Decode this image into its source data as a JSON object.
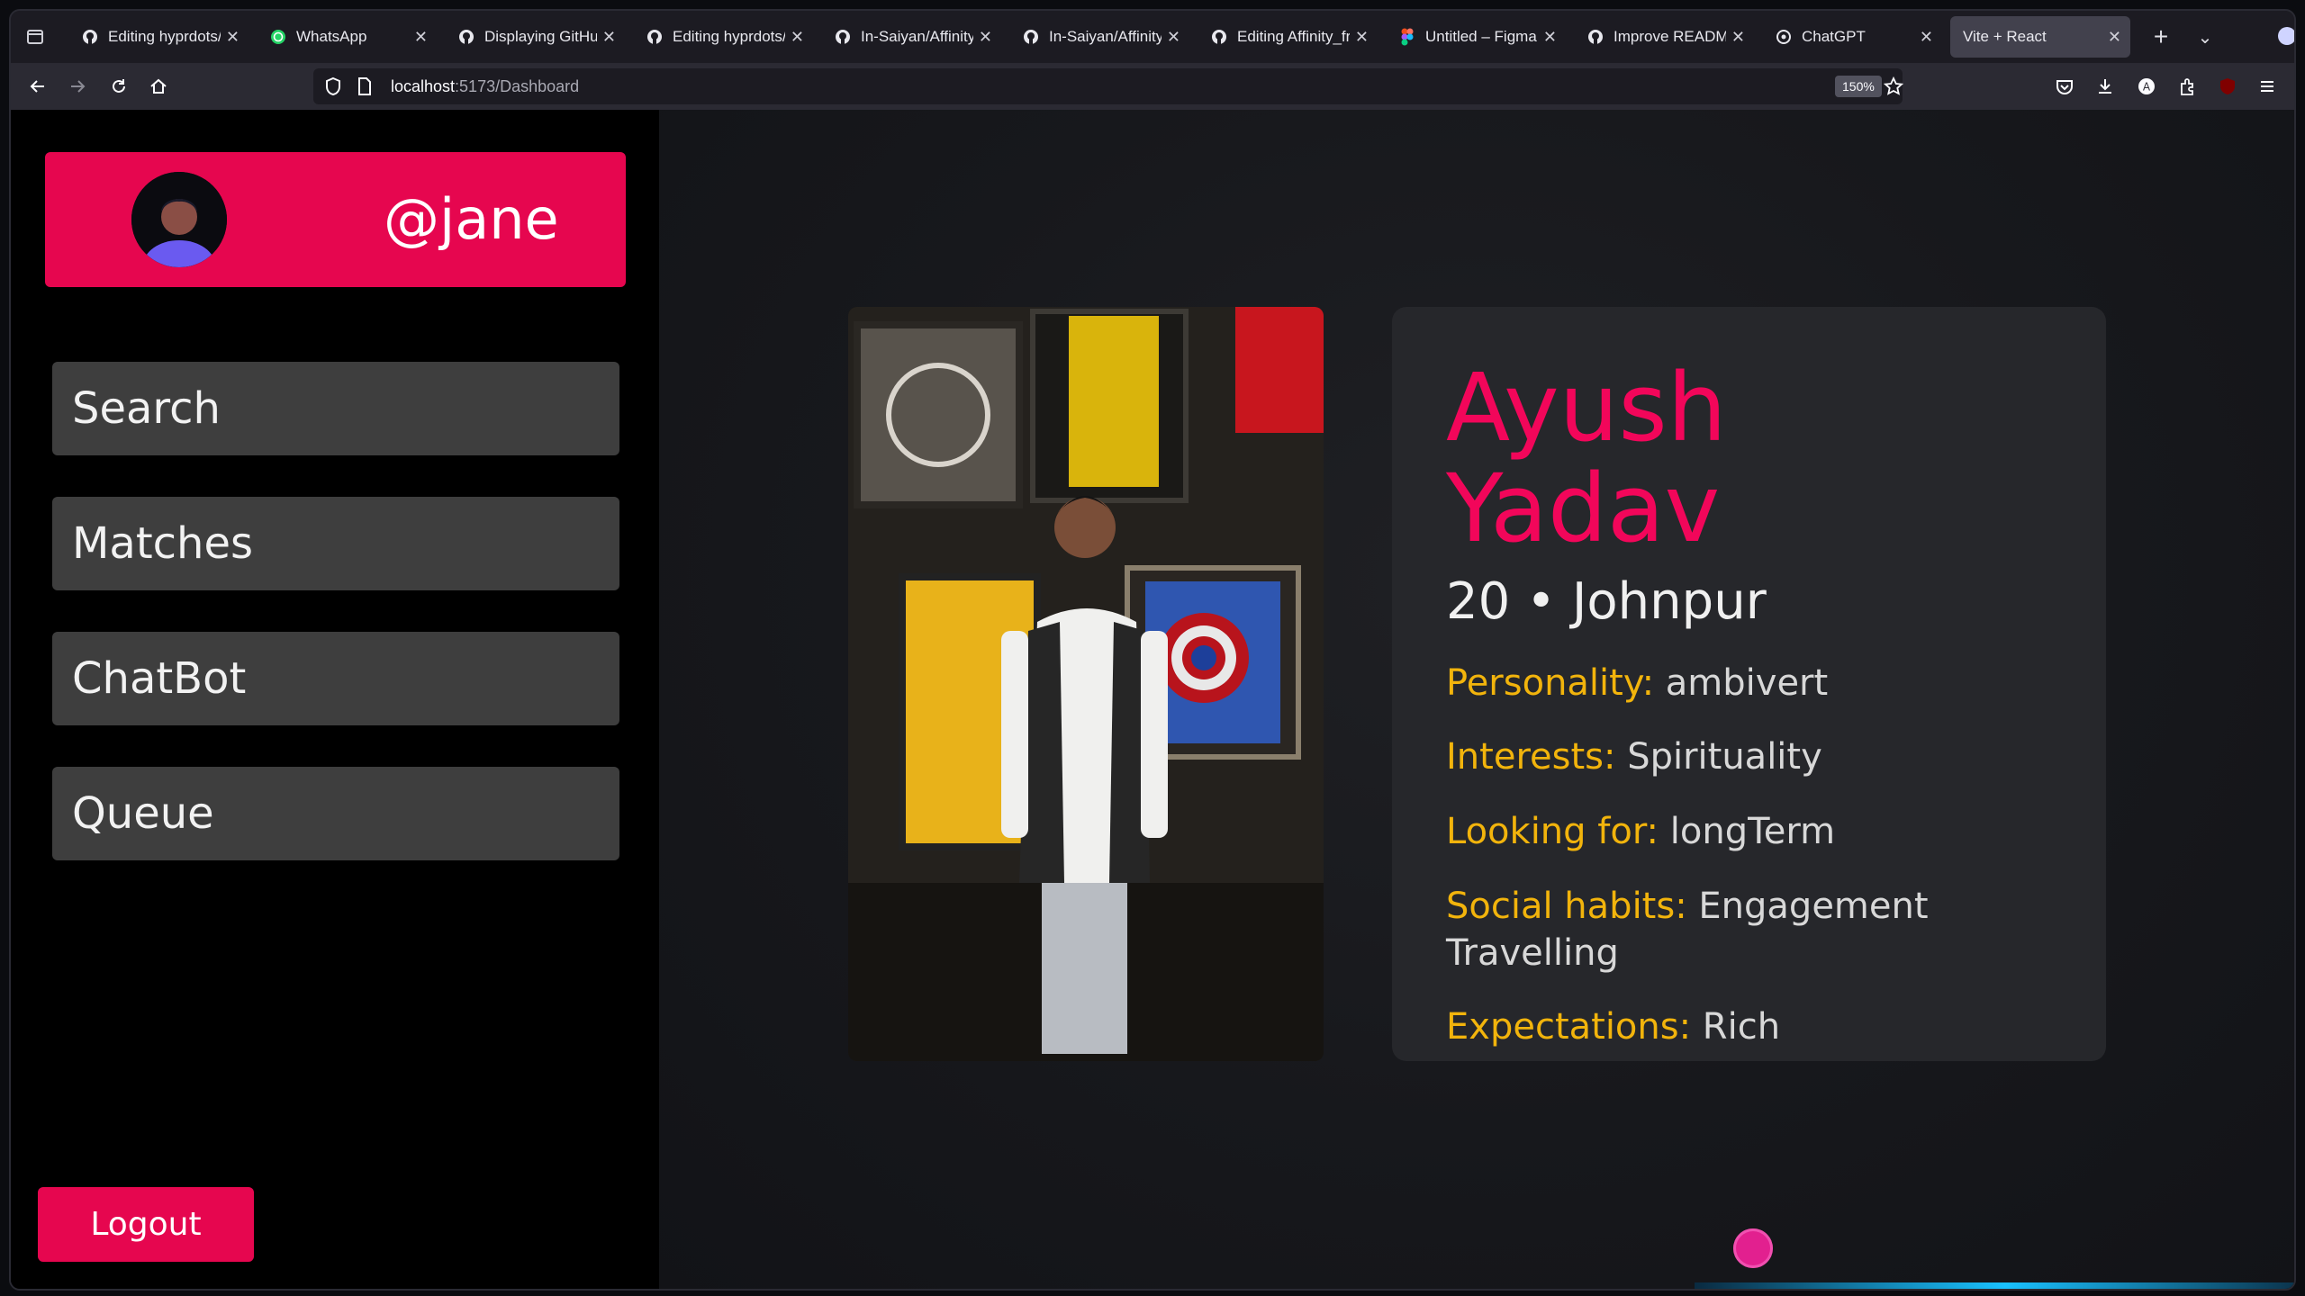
{
  "browser": {
    "tabs": [
      {
        "title": "Editing hyprdots/R",
        "icon": "github-icon"
      },
      {
        "title": "WhatsApp",
        "icon": "whatsapp-icon"
      },
      {
        "title": "Displaying GitHub",
        "icon": "github-icon"
      },
      {
        "title": "Editing hyprdots/R",
        "icon": "github-icon"
      },
      {
        "title": "In-Saiyan/Affinity_",
        "icon": "github-icon"
      },
      {
        "title": "In-Saiyan/Affinity_",
        "icon": "github-icon"
      },
      {
        "title": "Editing Affinity_fr",
        "icon": "github-icon"
      },
      {
        "title": "Untitled – Figma",
        "icon": "figma-icon"
      },
      {
        "title": "Improve README",
        "icon": "github-icon"
      },
      {
        "title": "ChatGPT",
        "icon": "chatgpt-icon"
      },
      {
        "title": "Vite + React",
        "icon": "none",
        "active": true
      }
    ],
    "url_host": "localhost",
    "url_path": ":5173/Dashboard",
    "zoom": "150%"
  },
  "sidebar": {
    "username": "@jane",
    "menu": [
      {
        "label": "Search"
      },
      {
        "label": "Matches"
      },
      {
        "label": "ChatBot"
      },
      {
        "label": "Queue"
      }
    ],
    "logout_label": "Logout"
  },
  "profile": {
    "first_name": "Ayush",
    "last_name": "Yadav",
    "age_city": "20 • Johnpur",
    "fields": [
      {
        "label": "Personality:",
        "value": "ambivert"
      },
      {
        "label": "Interests:",
        "value": "Spirituality"
      },
      {
        "label": "Looking for:",
        "value": "longTerm"
      },
      {
        "label": "Social habits:",
        "value": "Engagement Travelling"
      },
      {
        "label": "Expectations:",
        "value": "Rich"
      }
    ]
  },
  "colors": {
    "accent": "#e6064f",
    "name": "#f2065a",
    "label": "#f2b40c",
    "sidebar_bg": "#000000",
    "button_bg": "#3e3e3e"
  }
}
